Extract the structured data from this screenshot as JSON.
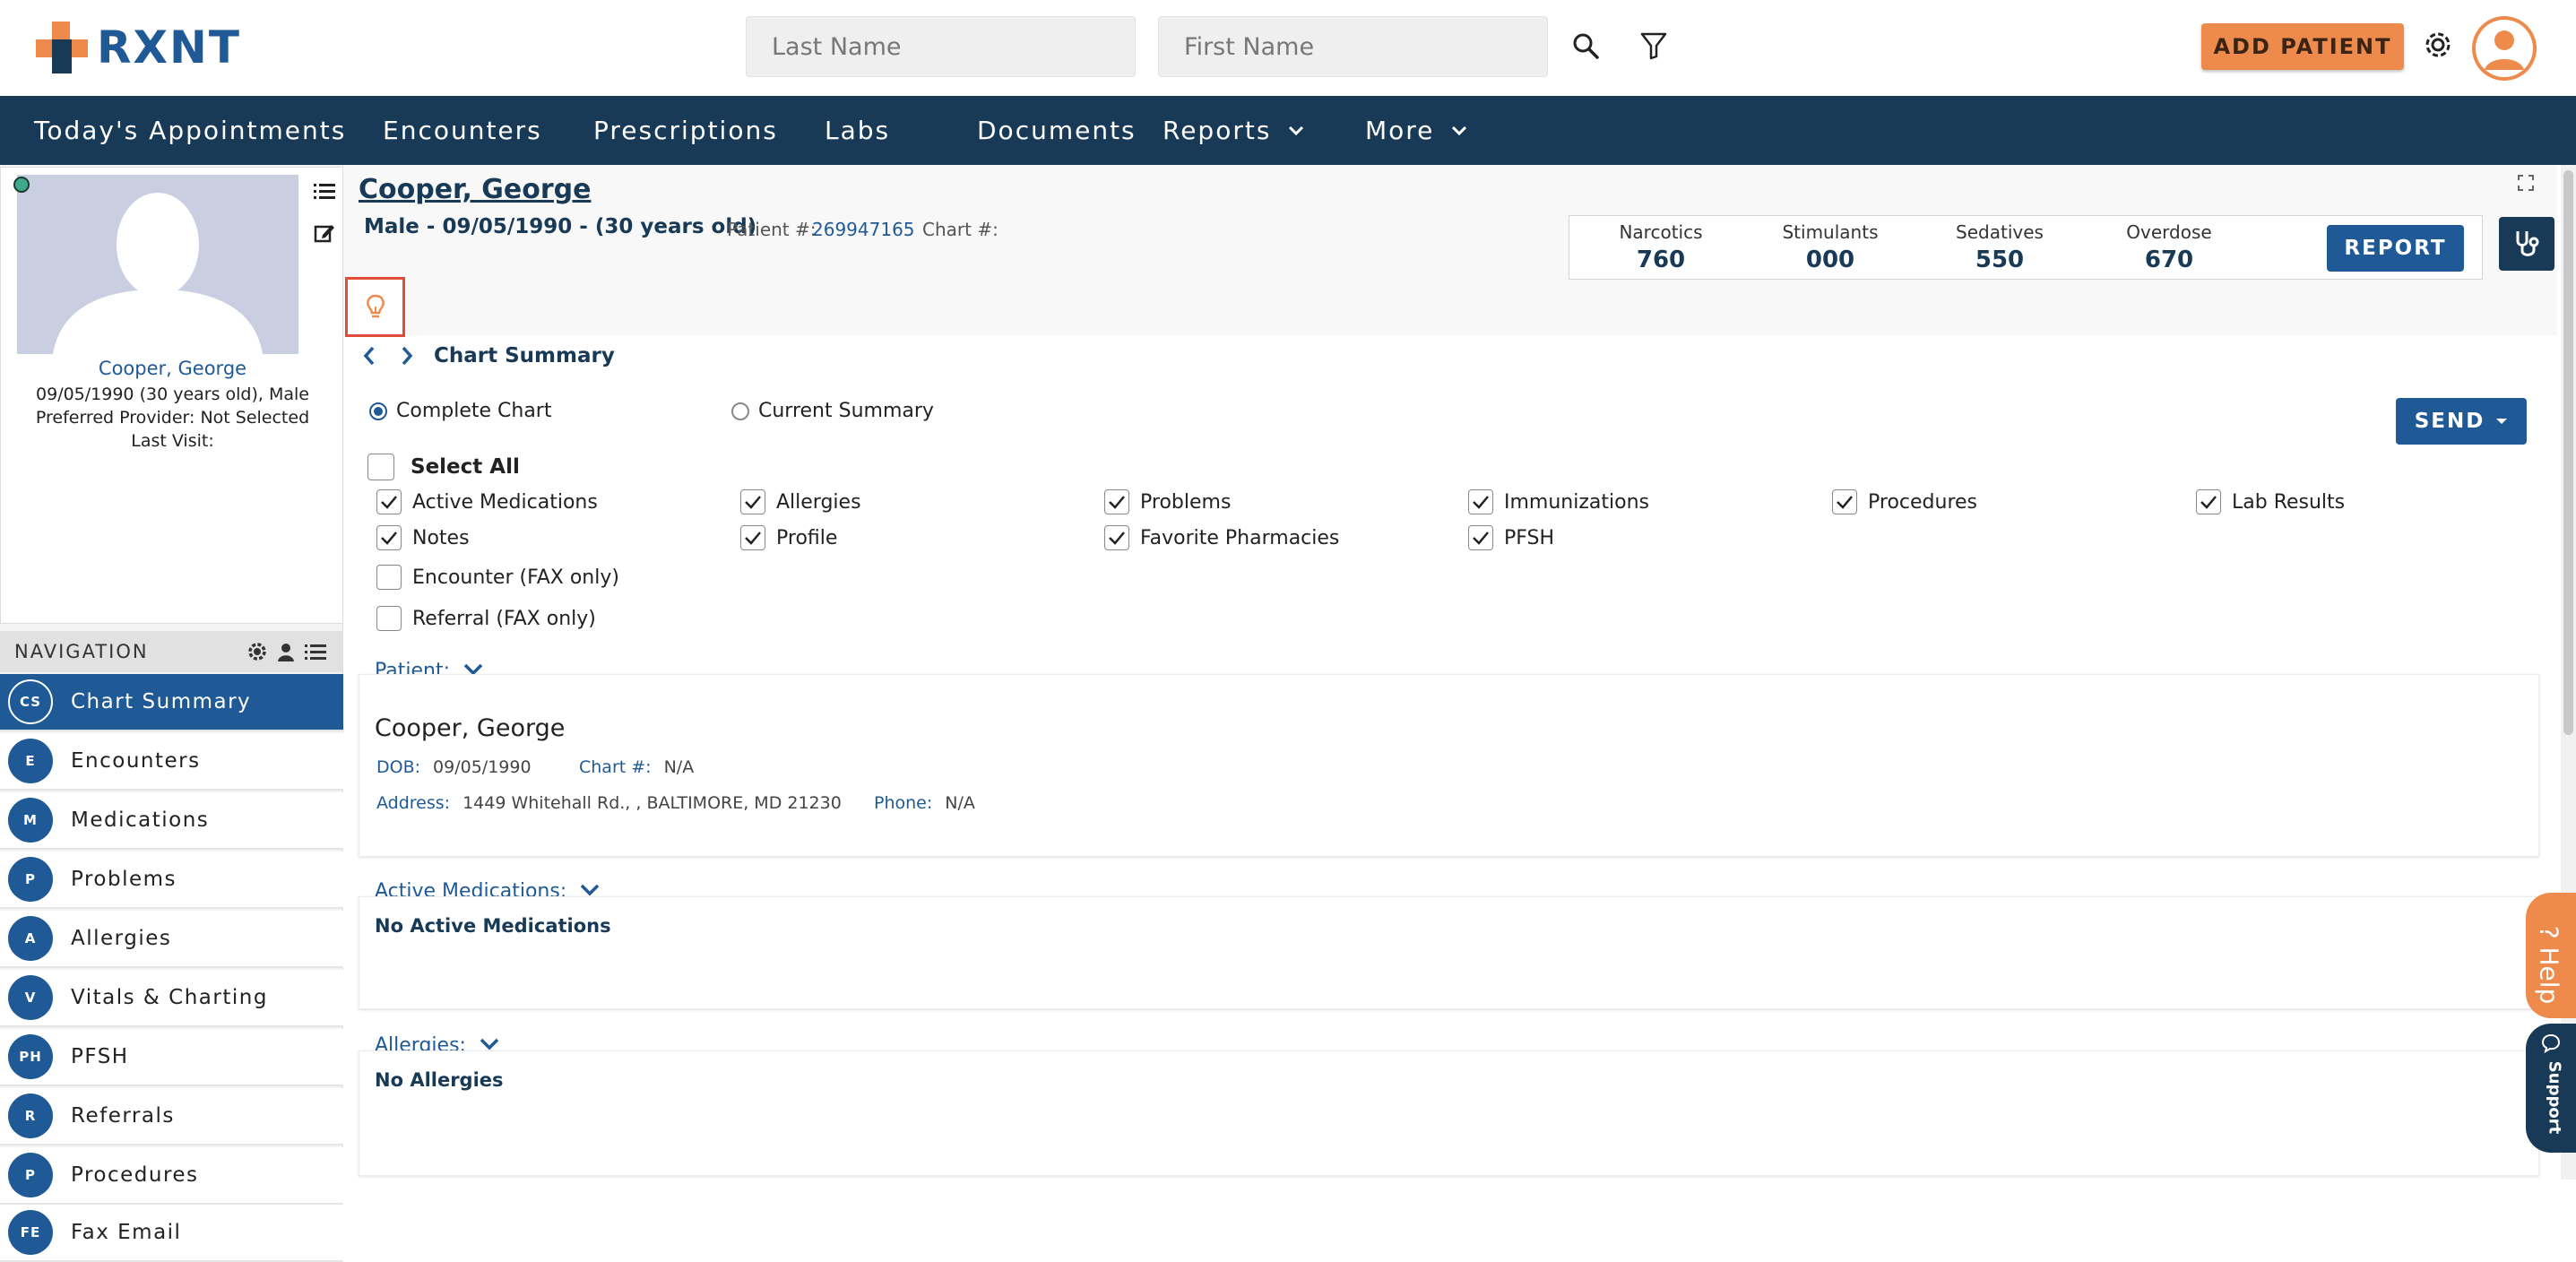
{
  "app": {
    "logo_text": "RXNT"
  },
  "search": {
    "last_name_placeholder": "Last Name",
    "first_name_placeholder": "First Name"
  },
  "header": {
    "add_patient_label": "ADD PATIENT"
  },
  "nav": {
    "items": [
      {
        "label": "Today's Appointments"
      },
      {
        "label": "Encounters"
      },
      {
        "label": "Prescriptions"
      },
      {
        "label": "Labs"
      },
      {
        "label": "Documents"
      },
      {
        "label": "Reports"
      },
      {
        "label": "More"
      }
    ]
  },
  "patient_card": {
    "name": "Cooper, George",
    "dob_line": "09/05/1990 (30 years old), Male",
    "provider_line": "Preferred Provider: Not Selected",
    "last_visit_line": "Last Visit:"
  },
  "sidebar": {
    "header": "NAVIGATION",
    "items": [
      {
        "abbr": "CS",
        "label": "Chart Summary"
      },
      {
        "abbr": "E",
        "label": "Encounters"
      },
      {
        "abbr": "M",
        "label": "Medications"
      },
      {
        "abbr": "P",
        "label": "Problems"
      },
      {
        "abbr": "A",
        "label": "Allergies"
      },
      {
        "abbr": "V",
        "label": "Vitals & Charting"
      },
      {
        "abbr": "PH",
        "label": "PFSH"
      },
      {
        "abbr": "R",
        "label": "Referrals"
      },
      {
        "abbr": "P",
        "label": "Procedures"
      },
      {
        "abbr": "FE",
        "label": "Fax Email"
      }
    ]
  },
  "patient": {
    "name_link": "Cooper, George",
    "summary": "Male - 09/05/1990 - (30 years old)",
    "patient_num_label": "Patient #:",
    "patient_num": "269947165",
    "chart_num_label": "Chart #:"
  },
  "stats": {
    "narcotics_label": "Narcotics",
    "narcotics": "760",
    "stimulants_label": "Stimulants",
    "stimulants": "000",
    "sedatives_label": "Sedatives",
    "sedatives": "550",
    "overdose_label": "Overdose",
    "overdose": "670",
    "report_label": "REPORT"
  },
  "chart_summary": {
    "title": "Chart Summary",
    "complete_chart": "Complete Chart",
    "current_summary": "Current Summary",
    "send_label": "SEND",
    "select_all": "Select All",
    "options": [
      {
        "label": "Active Medications",
        "checked": true
      },
      {
        "label": "Allergies",
        "checked": true
      },
      {
        "label": "Problems",
        "checked": true
      },
      {
        "label": "Immunizations",
        "checked": true
      },
      {
        "label": "Procedures",
        "checked": true
      },
      {
        "label": "Lab Results",
        "checked": true
      },
      {
        "label": "Notes",
        "checked": true
      },
      {
        "label": "Profile",
        "checked": true
      },
      {
        "label": "Favorite Pharmacies",
        "checked": true
      },
      {
        "label": "PFSH",
        "checked": true
      },
      {
        "label": "Encounter (FAX only)",
        "checked": false
      },
      {
        "label": "Referral (FAX only)",
        "checked": false
      }
    ]
  },
  "patient_section": {
    "label": "Patient:",
    "name": "Cooper, George",
    "dob_label": "DOB:",
    "dob": "09/05/1990",
    "chart_label": "Chart #:",
    "chart": "N/A",
    "address_label": "Address:",
    "address": "1449 Whitehall Rd., , BALTIMORE, MD 21230",
    "phone_label": "Phone:",
    "phone": "N/A"
  },
  "active_meds_section": {
    "label": "Active Medications:",
    "note": "No Active Medications"
  },
  "allergies_section": {
    "label": "Allergies:",
    "note": "No Allergies"
  },
  "help": {
    "help_label": "? Help",
    "support_label": "Support"
  },
  "colors": {
    "brand_dark": "#183a57",
    "brand_blue": "#1f5a96",
    "accent_orange": "#ee8a4c",
    "highlight_red": "#e24b35"
  }
}
